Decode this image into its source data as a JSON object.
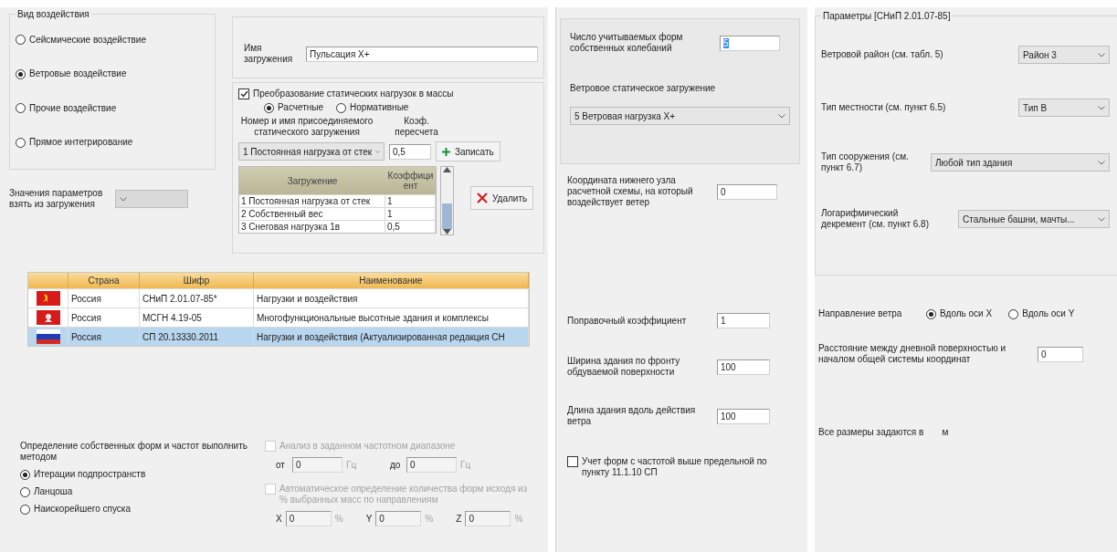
{
  "action_type": {
    "title": "Вид воздействия",
    "options": [
      {
        "label": "Сейсмические воздействие",
        "selected": false
      },
      {
        "label": "Ветровые воздействие",
        "selected": true
      },
      {
        "label": "Прочие воздействие",
        "selected": false
      },
      {
        "label": "Прямое интегрирование",
        "selected": false
      }
    ]
  },
  "params_source": {
    "label": "Значения параметров взять из загружения",
    "disabled": true
  },
  "load_name": {
    "label": "Имя загружения",
    "value": "Пульсация X+"
  },
  "mass_conversion": {
    "label": "Преобразование статических нагрузок в массы",
    "checked": true,
    "options": [
      {
        "label": "Расчетные",
        "selected": true
      },
      {
        "label": "Нормативные",
        "selected": false
      }
    ],
    "load_label": "Номер и имя присоединяемого статического загружения",
    "coef_label": "Коэф. пересчета",
    "load_value": "1 Постоянная нагрузка от стек",
    "coef_value": "0,5",
    "add_button": "Записать",
    "delete_button": "Удалить",
    "table": {
      "columns": [
        "Загружение",
        "Коэффициент"
      ],
      "rows": [
        [
          "1 Постоянная нагрузка от стек",
          "1"
        ],
        [
          "2 Собственный вес",
          "1"
        ],
        [
          "3 Снеговая нагрузка 1в",
          "0,5"
        ]
      ]
    }
  },
  "norms_table": {
    "columns": [
      "Страна",
      "Шифр",
      "Наименование"
    ],
    "rows": [
      {
        "country": "Россия",
        "code": "СНиП 2.01.07-85*",
        "name": "Нагрузки и воздействия",
        "selected": false
      },
      {
        "country": "Россия",
        "code": "МСГН 4.19-05",
        "name": "Многофункциональные высотные здания и комплексы",
        "selected": false
      },
      {
        "country": "Россия",
        "code": "СП 20.13330.2011",
        "name": "Нагрузки и воздействия (Актуализированная редакция СН",
        "selected": true
      }
    ]
  },
  "method": {
    "label": "Определение собственных форм и частот выполнить методом",
    "options": [
      {
        "label": "Итерации подпространств",
        "selected": true
      },
      {
        "label": "Ланцоша",
        "selected": false
      },
      {
        "label": "Наискорейшего спуска",
        "selected": false
      }
    ]
  },
  "freq_range": {
    "label": "Анализ в заданном частотном диапазоне",
    "checked": false,
    "disabled": true,
    "from_label": "от",
    "from_value": "0",
    "from_unit": "Гц",
    "to_label": "до",
    "to_value": "0",
    "to_unit": "Гц"
  },
  "auto_forms": {
    "label": "Автоматическое определение количества форм исходя из % выбранных масс по направлениям",
    "checked": false,
    "disabled": true,
    "axes": [
      {
        "label": "X",
        "value": "0",
        "unit": "%"
      },
      {
        "label": "Y",
        "value": "0",
        "unit": "%"
      },
      {
        "label": "Z",
        "value": "0",
        "unit": "%"
      }
    ]
  },
  "modes_count": {
    "label": "Число учитываемых форм собственных колебаний",
    "value": "5",
    "highlighted": true
  },
  "wind_static_load": {
    "label": "Ветровое статическое загружение",
    "value": "5  Ветровая нагрузка X+"
  },
  "base_node": {
    "label": "Координата нижнего узла расчетной схемы, на который воздействует ветер",
    "value": "0"
  },
  "correction_factor": {
    "label": "Поправочный коэффициент",
    "value": "1"
  },
  "building_width": {
    "label": "Ширина здания по фронту обдуваемой поверхности",
    "value": "100"
  },
  "building_length": {
    "label": "Длина здания вдоль действия ветра",
    "value": "100"
  },
  "higher_freq": {
    "label": "Учет форм с частотой выше предельной по пункту 11.1.10 СП",
    "checked": false
  },
  "parameters": {
    "title": "Параметры [СНиП 2.01.07-85]",
    "rows": [
      {
        "label": "Ветровой район (см. табл. 5)",
        "value": "Район 3"
      },
      {
        "label": "Тип местности (см. пункт 6.5)",
        "value": "Тип B"
      },
      {
        "label": "Тип сооружения (см. пункт 6.7)",
        "value": "Любой тип здания"
      },
      {
        "label": "Логарифмический декремент (см. пункт 6.8)",
        "value": "Стальные башни, мачты..."
      }
    ]
  },
  "wind_direction": {
    "label": "Направление ветра",
    "options": [
      {
        "label": "Вдоль оси X",
        "selected": true
      },
      {
        "label": "Вдоль оси Y",
        "selected": false
      }
    ]
  },
  "surface_distance": {
    "label": "Расстояние между дневной поверхностью и началом общей системы координат",
    "value": "0"
  },
  "units": {
    "label": "Все размеры задаются в",
    "value": "м"
  }
}
